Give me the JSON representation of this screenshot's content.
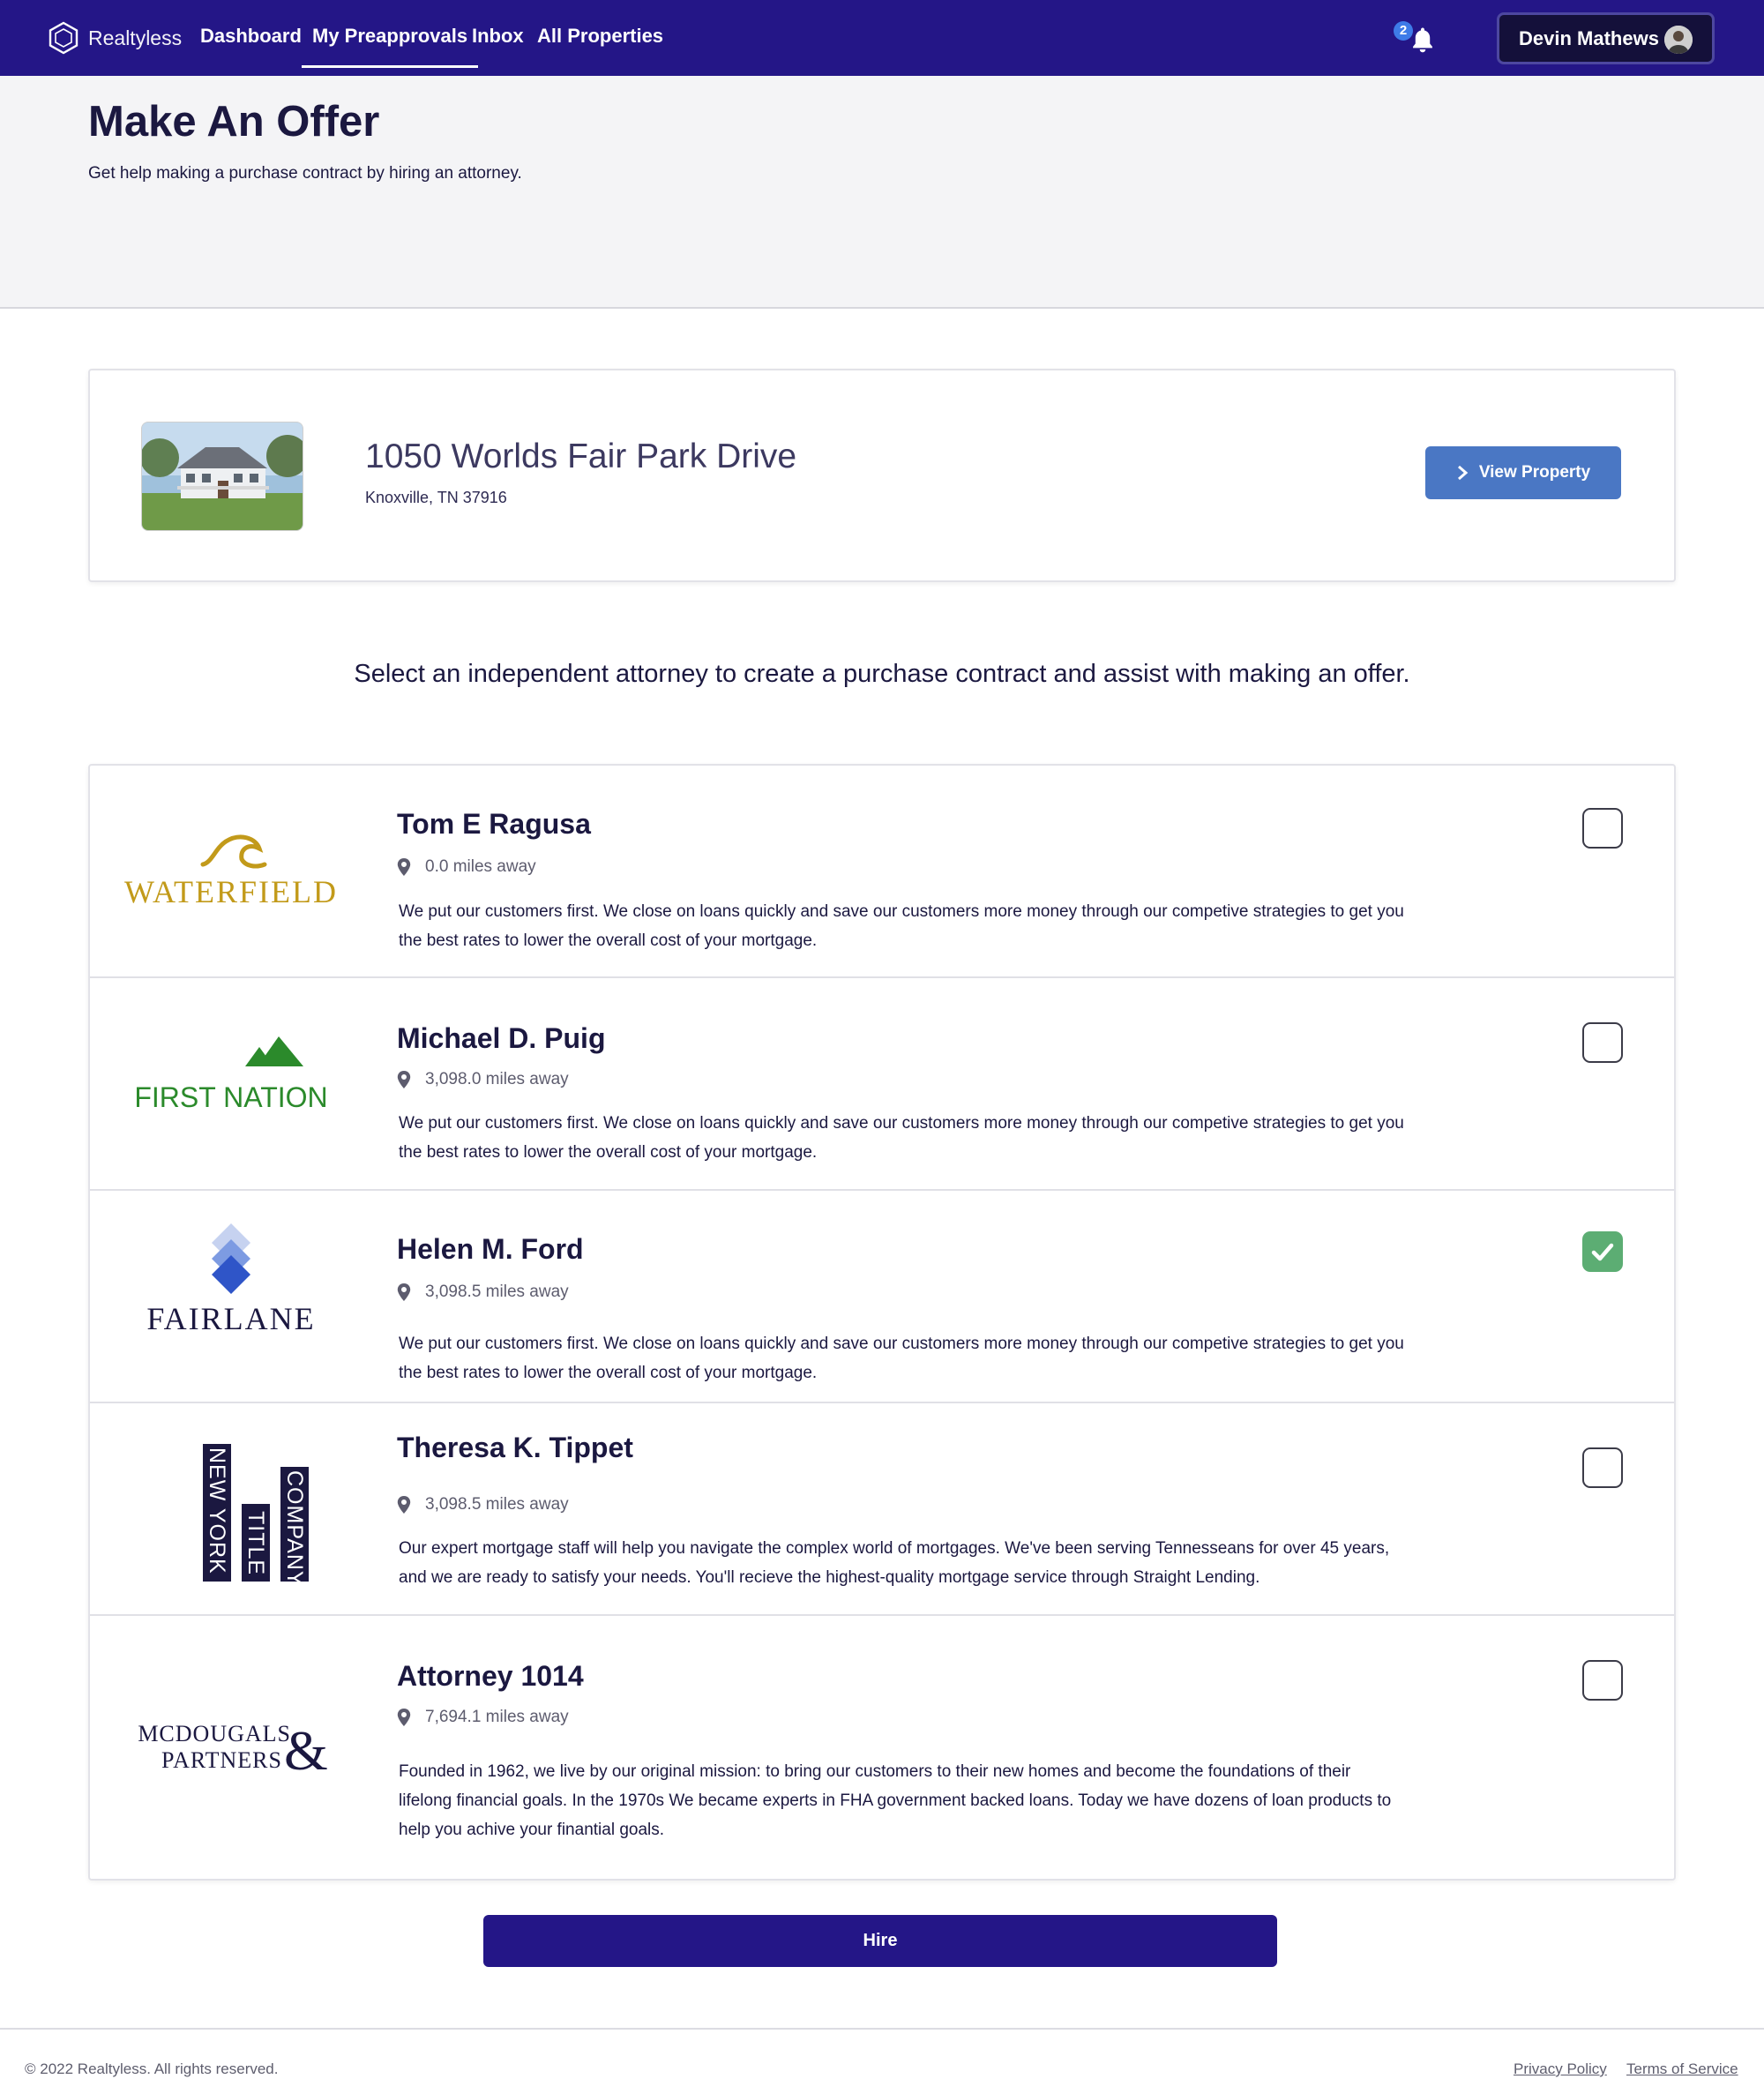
{
  "nav": {
    "brand": "Realtyless",
    "links": [
      {
        "label": "Dashboard"
      },
      {
        "label": "My Preapprovals"
      },
      {
        "label": "Inbox"
      },
      {
        "label": "All Properties"
      }
    ],
    "active_link": "My Preapprovals",
    "notification_count": "2",
    "user_name": "Devin Mathews",
    "colors": {
      "nav_bg": "#241687",
      "badge": "#3e7be8"
    }
  },
  "header": {
    "title": "Make An Offer",
    "subtitle": "Get help making a purchase contract by hiring an attorney."
  },
  "property": {
    "address": "1050 Worlds Fair Park Drive",
    "city": "Knoxville, TN 37916",
    "view_button": "View Property",
    "button_color": "#4a77c4"
  },
  "instructions": "Select an independent attorney to create a purchase contract and assist with making an offer.",
  "attorneys": [
    {
      "name": "Tom E Ragusa",
      "distance": "0.0 miles away",
      "description": "We put our customers first. We close on loans quickly and save our customers more money through our competive strategies to get you the best rates to lower the overall cost of your mortgage.",
      "logo_text": "WATERFIELD",
      "selected": false
    },
    {
      "name": "Michael D. Puig",
      "distance": "3,098.0 miles away",
      "description": "We put our customers first. We close on loans quickly and save our customers more money through our competive strategies to get you the best rates to lower the overall cost of your mortgage.",
      "logo_text": "FIRST NATION",
      "selected": false
    },
    {
      "name": "Helen M. Ford",
      "distance": "3,098.5 miles away",
      "description": "We put our customers first. We close on loans quickly and save our customers more money through our competive strategies to get you the best rates to lower the overall cost of your mortgage.",
      "logo_text": "FAIRLANE",
      "selected": true
    },
    {
      "name": "Theresa K. Tippet",
      "distance": "3,098.5 miles away",
      "description": "Our expert mortgage staff will help you navigate the complex world of mortgages. We've been serving Tennesseans for over 45 years, and we are ready to satisfy your needs. You'll recieve the highest-quality mortgage service through Straight Lending.",
      "logo_text": [
        "NEW YORK",
        "TITLE",
        "COMPANY"
      ],
      "selected": false
    },
    {
      "name": "Attorney 1014",
      "distance": "7,694.1 miles away",
      "description": "Founded in 1962, we live by our original mission: to bring our customers to their new homes and become the foundations of their lifelong financial goals. In the 1970s We became experts in FHA government backed loans. Today we have dozens of loan products to help you achive your finantial goals.",
      "logo_text": [
        "MCDOUGALS",
        "PARTNERS",
        "&"
      ],
      "selected": false
    }
  ],
  "hire_button": "Hire",
  "footer": {
    "copyright": "© 2022 Realtyless. All rights reserved.",
    "privacy": "Privacy Policy",
    "terms": "Terms of Service"
  },
  "colors": {
    "primary": "#241687",
    "check_selected": "#5cad73",
    "text_dark": "#1b1840"
  },
  "icons": [
    "realtyless-logo-icon",
    "bell-icon",
    "chevron-right-icon",
    "map-pin-icon",
    "check-icon"
  ]
}
